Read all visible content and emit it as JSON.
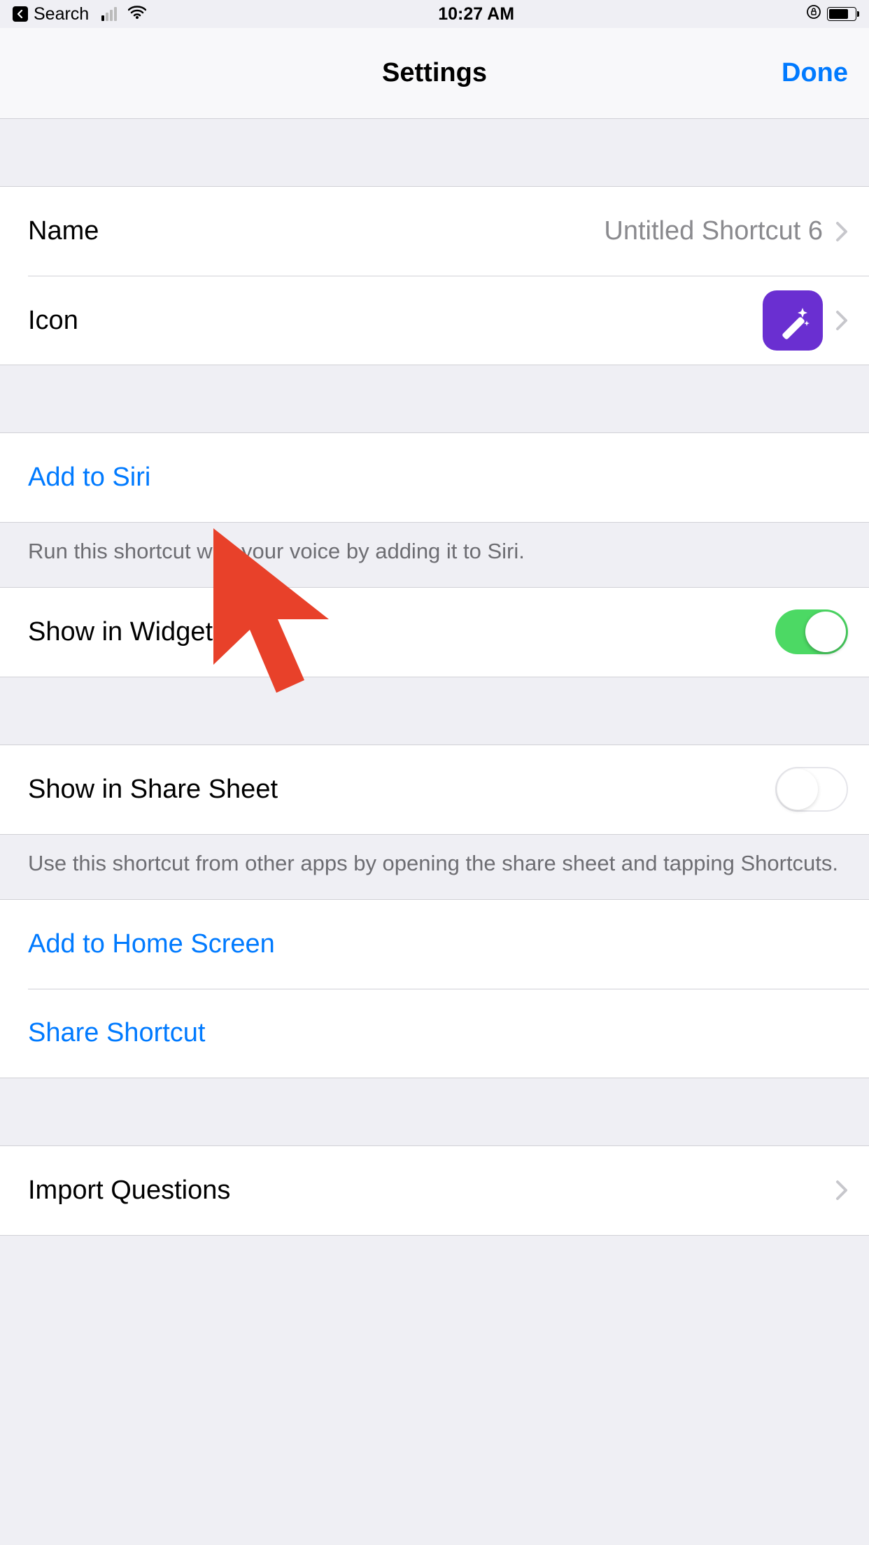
{
  "status": {
    "back_label": "Search",
    "time": "10:27 AM"
  },
  "nav": {
    "title": "Settings",
    "done": "Done"
  },
  "group1": {
    "name_label": "Name",
    "name_value": "Untitled Shortcut 6",
    "icon_label": "Icon"
  },
  "group2": {
    "siri_label": "Add to Siri",
    "siri_footer": "Run this shortcut with your voice by adding it to Siri."
  },
  "group3": {
    "widget_label": "Show in Widget",
    "widget_on": true
  },
  "group4": {
    "share_sheet_label": "Show in Share Sheet",
    "share_sheet_on": false,
    "share_sheet_footer": "Use this shortcut from other apps by opening the share sheet and tapping Shortcuts."
  },
  "group5": {
    "home_label": "Add to Home Screen",
    "share_shortcut_label": "Share Shortcut"
  },
  "group6": {
    "import_label": "Import Questions"
  }
}
